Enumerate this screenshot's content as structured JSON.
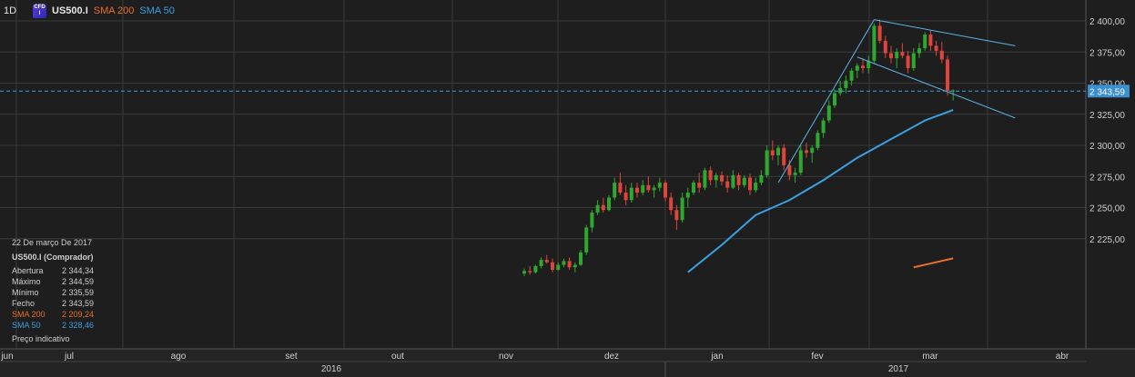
{
  "header": {
    "timeframe": "1D",
    "badge": "CFD",
    "symbol": "US500.I",
    "sma200_label": "SMA 200",
    "sma50_label": "SMA 50"
  },
  "info_panel": {
    "date": "22 De março De 2017",
    "title": "US500.I (Comprador)",
    "rows": [
      {
        "key": "Abertura",
        "value": "2 344,34"
      },
      {
        "key": "Máximo",
        "value": "2 344,59"
      },
      {
        "key": "Mínimo",
        "value": "2 335,59"
      },
      {
        "key": "Fecho",
        "value": "2 343,59"
      },
      {
        "key": "SMA 200",
        "value": "2 209,24"
      },
      {
        "key": "SMA 50",
        "value": "2 328,46"
      }
    ],
    "note": "Preço indicativo"
  },
  "colors": {
    "background": "#1e1e1e",
    "grid": "#3a3a3a",
    "up": "#2ea82e",
    "down": "#e0443c",
    "sma200": "#e8702a",
    "sma50": "#3aa0e0",
    "price_line": "#3aa0e0",
    "trendline": "#5ab4e6"
  },
  "chart_data": {
    "type": "candlestick",
    "ylim": [
      2200,
      2410
    ],
    "y_ticks": [
      "2 225,00",
      "2 250,00",
      "2 275,00",
      "2 300,00",
      "2 325,00",
      "2 350,00",
      "2 375,00",
      "2 400,00"
    ],
    "y_tick_values": [
      2225,
      2250,
      2275,
      2300,
      2325,
      2350,
      2375,
      2400
    ],
    "month_labels": [
      "jun",
      "jul",
      "ago",
      "set",
      "out",
      "nov",
      "dez",
      "jan",
      "fev",
      "mar",
      "abr"
    ],
    "year_labels": [
      "2016",
      "2017"
    ],
    "current_price": 2343.59,
    "current_price_label": "2 343,59",
    "candles": [
      [
        2197,
        2201,
        2195,
        2199
      ],
      [
        2199,
        2203,
        2196,
        2198
      ],
      [
        2198,
        2204,
        2197,
        2203
      ],
      [
        2203,
        2210,
        2201,
        2208
      ],
      [
        2208,
        2212,
        2205,
        2206
      ],
      [
        2206,
        2209,
        2198,
        2200
      ],
      [
        2200,
        2206,
        2199,
        2204
      ],
      [
        2204,
        2209,
        2202,
        2207
      ],
      [
        2207,
        2210,
        2200,
        2202
      ],
      [
        2202,
        2206,
        2198,
        2204
      ],
      [
        2204,
        2216,
        2203,
        2214
      ],
      [
        2214,
        2236,
        2212,
        2234
      ],
      [
        2234,
        2248,
        2230,
        2246
      ],
      [
        2246,
        2256,
        2244,
        2252
      ],
      [
        2252,
        2258,
        2246,
        2248
      ],
      [
        2248,
        2260,
        2247,
        2258
      ],
      [
        2258,
        2274,
        2256,
        2270
      ],
      [
        2270,
        2278,
        2260,
        2262
      ],
      [
        2262,
        2268,
        2252,
        2256
      ],
      [
        2256,
        2270,
        2254,
        2266
      ],
      [
        2266,
        2270,
        2258,
        2262
      ],
      [
        2262,
        2272,
        2260,
        2268
      ],
      [
        2268,
        2275,
        2262,
        2264
      ],
      [
        2264,
        2268,
        2258,
        2266
      ],
      [
        2266,
        2274,
        2263,
        2270
      ],
      [
        2270,
        2272,
        2255,
        2258
      ],
      [
        2258,
        2262,
        2244,
        2248
      ],
      [
        2248,
        2252,
        2232,
        2240
      ],
      [
        2240,
        2262,
        2238,
        2258
      ],
      [
        2258,
        2266,
        2250,
        2262
      ],
      [
        2262,
        2272,
        2260,
        2270
      ],
      [
        2270,
        2278,
        2262,
        2266
      ],
      [
        2266,
        2282,
        2264,
        2280
      ],
      [
        2280,
        2283,
        2268,
        2272
      ],
      [
        2272,
        2278,
        2266,
        2276
      ],
      [
        2276,
        2279,
        2268,
        2271
      ],
      [
        2271,
        2276,
        2262,
        2266
      ],
      [
        2266,
        2280,
        2265,
        2276
      ],
      [
        2276,
        2278,
        2264,
        2268
      ],
      [
        2268,
        2276,
        2266,
        2274
      ],
      [
        2274,
        2277,
        2260,
        2264
      ],
      [
        2264,
        2274,
        2262,
        2270
      ],
      [
        2270,
        2280,
        2268,
        2276
      ],
      [
        2276,
        2300,
        2274,
        2296
      ],
      [
        2296,
        2304,
        2288,
        2292
      ],
      [
        2292,
        2300,
        2284,
        2298
      ],
      [
        2298,
        2301,
        2280,
        2284
      ],
      [
        2284,
        2288,
        2272,
        2276
      ],
      [
        2276,
        2282,
        2270,
        2278
      ],
      [
        2278,
        2300,
        2276,
        2296
      ],
      [
        2296,
        2302,
        2290,
        2294
      ],
      [
        2294,
        2300,
        2286,
        2298
      ],
      [
        2298,
        2312,
        2296,
        2310
      ],
      [
        2310,
        2322,
        2306,
        2320
      ],
      [
        2320,
        2336,
        2318,
        2332
      ],
      [
        2332,
        2345,
        2330,
        2342
      ],
      [
        2342,
        2352,
        2340,
        2346
      ],
      [
        2346,
        2356,
        2342,
        2352
      ],
      [
        2352,
        2362,
        2348,
        2360
      ],
      [
        2360,
        2366,
        2354,
        2364
      ],
      [
        2364,
        2370,
        2358,
        2362
      ],
      [
        2362,
        2372,
        2358,
        2368
      ],
      [
        2368,
        2398,
        2366,
        2396
      ],
      [
        2396,
        2401,
        2382,
        2384
      ],
      [
        2384,
        2388,
        2370,
        2374
      ],
      [
        2374,
        2380,
        2366,
        2370
      ],
      [
        2370,
        2378,
        2362,
        2375
      ],
      [
        2375,
        2382,
        2370,
        2372
      ],
      [
        2372,
        2376,
        2358,
        2362
      ],
      [
        2362,
        2378,
        2360,
        2374
      ],
      [
        2374,
        2382,
        2370,
        2378
      ],
      [
        2378,
        2391,
        2376,
        2389
      ],
      [
        2389,
        2392,
        2376,
        2380
      ],
      [
        2380,
        2384,
        2372,
        2376
      ],
      [
        2376,
        2383,
        2366,
        2369
      ],
      [
        2369,
        2372,
        2340,
        2344
      ],
      [
        2344,
        2345,
        2336,
        2344
      ]
    ],
    "sma50": {
      "label": "SMA 50",
      "x_index": [
        29,
        35,
        41,
        47,
        53,
        59,
        65,
        71,
        76
      ],
      "values": [
        2198,
        2220,
        2244,
        2256,
        2272,
        2290,
        2305,
        2320,
        2328.46
      ]
    },
    "sma200": {
      "label": "SMA 200",
      "x_index": [
        69,
        76
      ],
      "values": [
        2202,
        2209.24
      ]
    },
    "trendlines": [
      {
        "x_index": [
          45,
          62
        ],
        "values": [
          2270,
          2401
        ]
      },
      {
        "x_index": [
          62,
          87
        ],
        "values": [
          2401,
          2380
        ]
      },
      {
        "x_index": [
          59,
          87
        ],
        "values": [
          2371,
          2322
        ]
      }
    ]
  }
}
